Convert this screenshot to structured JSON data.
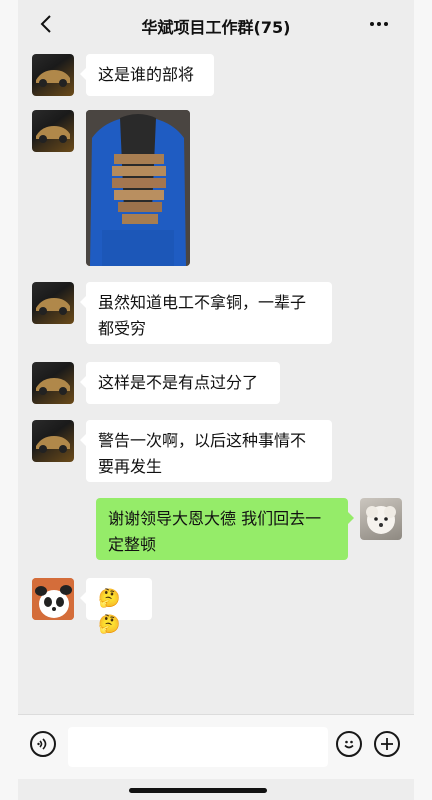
{
  "header": {
    "title": "华斌项目工作群(75)"
  },
  "messages": [
    {
      "sender": "other",
      "avatar": "car-avatar",
      "type": "text",
      "text": "这是谁的部将"
    },
    {
      "sender": "other",
      "avatar": "car-avatar",
      "type": "image",
      "image": "person-in-blue-jacket-wrapped-in-bundles-of-cash"
    },
    {
      "sender": "other",
      "avatar": "car-avatar",
      "type": "text",
      "text": "虽然知道电工不拿铜，一辈子都受穷"
    },
    {
      "sender": "other",
      "avatar": "car-avatar",
      "type": "text",
      "text": "这样是不是有点过分了"
    },
    {
      "sender": "other",
      "avatar": "car-avatar",
      "type": "text",
      "text": "警告一次啊，以后这种事情不要再发生"
    },
    {
      "sender": "self",
      "avatar": "dog-avatar",
      "type": "text",
      "text": "谢谢领导大恩大德 我们回去一定整顿"
    },
    {
      "sender": "other",
      "avatar": "panda-avatar",
      "type": "text",
      "text": "🤔🤔"
    }
  ],
  "inputbar": {
    "voice_icon": "voice-icon",
    "emoji_icon": "emoji-icon",
    "plus_icon": "plus-icon"
  },
  "colors": {
    "background": "#ededed",
    "bubble_other": "#ffffff",
    "bubble_self": "#95ec69"
  }
}
